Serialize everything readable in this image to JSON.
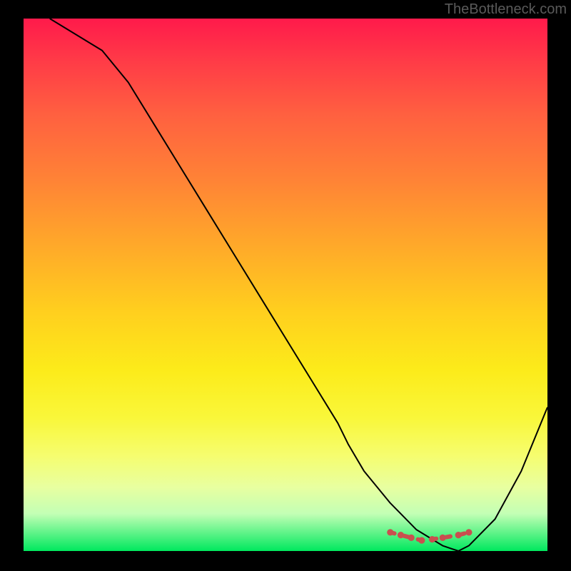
{
  "watermark": "TheBottleneck.com",
  "chart_data": {
    "type": "line",
    "title": "",
    "xlabel": "",
    "ylabel": "",
    "xlim": [
      0,
      100
    ],
    "ylim": [
      0,
      100
    ],
    "series": [
      {
        "name": "primary-curve",
        "x": [
          5,
          10,
          15,
          20,
          25,
          30,
          35,
          40,
          45,
          50,
          55,
          60,
          62,
          65,
          70,
          75,
          80,
          83,
          85,
          90,
          95,
          100
        ],
        "y": [
          100,
          97,
          94,
          88,
          80,
          72,
          64,
          56,
          48,
          40,
          32,
          24,
          20,
          15,
          9,
          4,
          1,
          0,
          1,
          6,
          15,
          27
        ],
        "color": "#000000",
        "width": 2
      },
      {
        "name": "minimum-marker",
        "x": [
          70,
          72,
          74,
          76,
          78,
          80,
          83,
          85
        ],
        "y": [
          3.5,
          3.0,
          2.5,
          2.0,
          2.2,
          2.5,
          3.0,
          3.5
        ],
        "color": "#c94f4f",
        "width": 6,
        "style": "dotted"
      }
    ]
  }
}
